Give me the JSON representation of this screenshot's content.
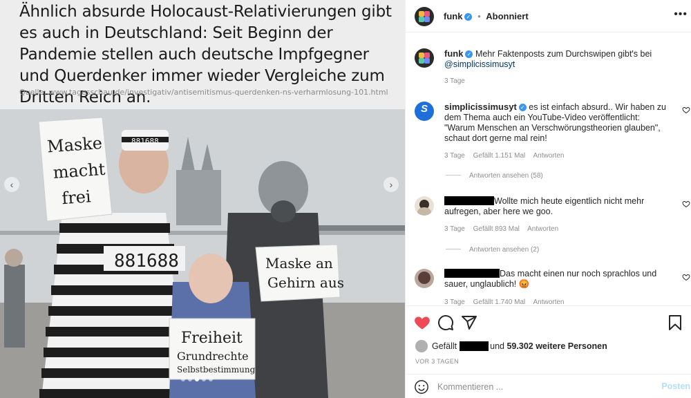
{
  "post": {
    "headline": "Ähnlich absurde Holocaust-Relativierungen gibt es auch in Deutschland: Seit Beginn der Pandemie stellen auch deutsche Impfgegner und Querdenker immer wieder Vergleiche zum Dritten Reich an.",
    "source": "Quelle: www.tagesschau.de/investigativ/antisemitismus-querdenken-ns-verharmlosung-101.html",
    "signs": {
      "sign1": [
        "Maske",
        "macht",
        "frei"
      ],
      "sign2": [
        "Maske an",
        "Gehirn aus"
      ],
      "sign3": [
        "Freiheit",
        "Grundrechte",
        "Selbstbestimmung"
      ],
      "prisoner_number": "881688",
      "cap_number": "881688"
    },
    "nav": {
      "prev_icon": "chevron-left-icon",
      "next_icon": "chevron-right-icon"
    }
  },
  "header": {
    "username": "funk",
    "separator": "•",
    "follow_state": "Abonniert",
    "more_icon": "more-options-icon"
  },
  "comments": [
    {
      "username": "funk",
      "text": "Mehr Faktenposts zum Durchswipen gibt's bei",
      "mention": "@simplicissimusyt",
      "time": "3 Tage"
    },
    {
      "username": "simplicissimusyt",
      "text": "es ist einfach absurd.. Wir haben zu dem Thema auch ein YouTube-Video veröffentlicht: \"Warum Menschen an Verschwörungstheorien glauben\", schaut dort gerne mal rein!",
      "time": "3 Tage",
      "likes": "Gefällt 1.151 Mal",
      "reply": "Antworten",
      "view_replies": "Antworten ansehen (58)"
    },
    {
      "username": "",
      "text": "Wollte mich heute eigentlich nicht mehr aufregen, aber here we goo.",
      "time": "3 Tage",
      "likes": "Gefällt 893 Mal",
      "reply": "Antworten",
      "view_replies": "Antworten ansehen (2)"
    },
    {
      "username": "",
      "text": "Das macht einen nur noch sprachlos und sauer, unglaublich!",
      "emoji": "😡",
      "time": "3 Tage",
      "likes": "Gefällt 1.740 Mal",
      "reply": "Antworten"
    }
  ],
  "actions": {
    "liked": true,
    "like_color": "#ed4956",
    "likes_prefix": "Gefällt",
    "likes_suffix": "und",
    "likes_count": "59.302 weitere Personen",
    "posted_ago": "VOR 3 TAGEN"
  },
  "composer": {
    "placeholder": "Kommentieren ...",
    "post_label": "Posten",
    "post_label_color": "#b2dffc"
  },
  "colors": {
    "verified": "#3897f0",
    "muted": "#8e8e8e",
    "text": "#262626"
  }
}
